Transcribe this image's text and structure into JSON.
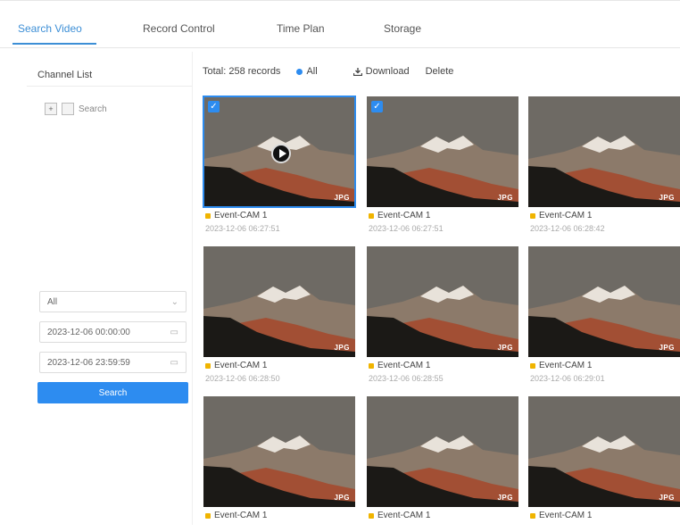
{
  "tabs": [
    {
      "label": "Search Video",
      "active": true
    },
    {
      "label": "Record Control",
      "active": false
    },
    {
      "label": "Time Plan",
      "active": false
    },
    {
      "label": "Storage",
      "active": false
    }
  ],
  "sidebar": {
    "title": "Channel List",
    "tree_item": "Search",
    "type_value": "All",
    "start_time": "2023-12-06 00:00:00",
    "end_time": "2023-12-06 23:59:59",
    "search_label": "Search"
  },
  "toolbar": {
    "total": "Total: 258 records",
    "all_label": "All",
    "download_label": "Download",
    "delete_label": "Delete"
  },
  "colors": {
    "accent": "#2d8cf0",
    "tab_active": "#3d8fd6",
    "badge": "#f0b400"
  },
  "cards": [
    {
      "name": "Event-CAM 1",
      "time": "2023-12-06 06:27:51",
      "tag": "JPG",
      "selected": true
    },
    {
      "name": "Event-CAM 1",
      "time": "2023-12-06 06:27:51",
      "tag": "JPG",
      "selected": true
    },
    {
      "name": "Event-CAM 1",
      "time": "2023-12-06 06:28:42",
      "tag": "JPG",
      "selected": false
    },
    {
      "name": "Event-CAM 1",
      "time": "2023-12-06 06:28:50",
      "tag": "JPG",
      "selected": false
    },
    {
      "name": "Event-CAM 1",
      "time": "2023-12-06 06:28:55",
      "tag": "JPG",
      "selected": false
    },
    {
      "name": "Event-CAM 1",
      "time": "2023-12-06 06:29:01",
      "tag": "JPG",
      "selected": false
    },
    {
      "name": "Event-CAM 1",
      "time": "",
      "tag": "JPG",
      "selected": false
    },
    {
      "name": "Event-CAM 1",
      "time": "",
      "tag": "JPG",
      "selected": false
    },
    {
      "name": "Event-CAM 1",
      "time": "",
      "tag": "JPG",
      "selected": false
    }
  ]
}
